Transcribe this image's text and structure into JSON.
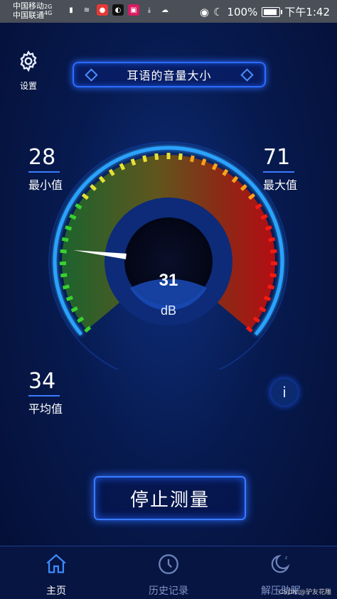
{
  "status_bar": {
    "carrier1": "中国移动",
    "carrier2": "中国联通",
    "net1": "2G",
    "net2": "4G",
    "battery": "100%",
    "time": "下午1:42",
    "icons": [
      "signal-icon",
      "wifi-icon",
      "mic-icon",
      "app-icon",
      "app2-icon",
      "download-icon",
      "cloud-icon",
      "eye-icon",
      "moon-icon",
      "battery-icon"
    ]
  },
  "settings": {
    "label": "设置",
    "icon": "gear-icon"
  },
  "title": "耳语的音量大小",
  "stats": {
    "min": {
      "value": "28",
      "label": "最小值"
    },
    "max": {
      "value": "71",
      "label": "最大值"
    },
    "avg": {
      "value": "34",
      "label": "平均值"
    }
  },
  "gauge": {
    "value": "31",
    "unit": "dB",
    "fraction": 0.18
  },
  "info_label": "i",
  "stop_button": "停止测量",
  "tabs": [
    {
      "label": "主页",
      "icon": "home-icon",
      "active": true
    },
    {
      "label": "历史记录",
      "icon": "clock-icon",
      "active": false
    },
    {
      "label": "解压助眠",
      "icon": "moon-icon",
      "active": false
    }
  ],
  "watermark": "CSDN @驴友花雕",
  "colors": {
    "accent": "#2b6cff",
    "background": "#071a4f"
  }
}
